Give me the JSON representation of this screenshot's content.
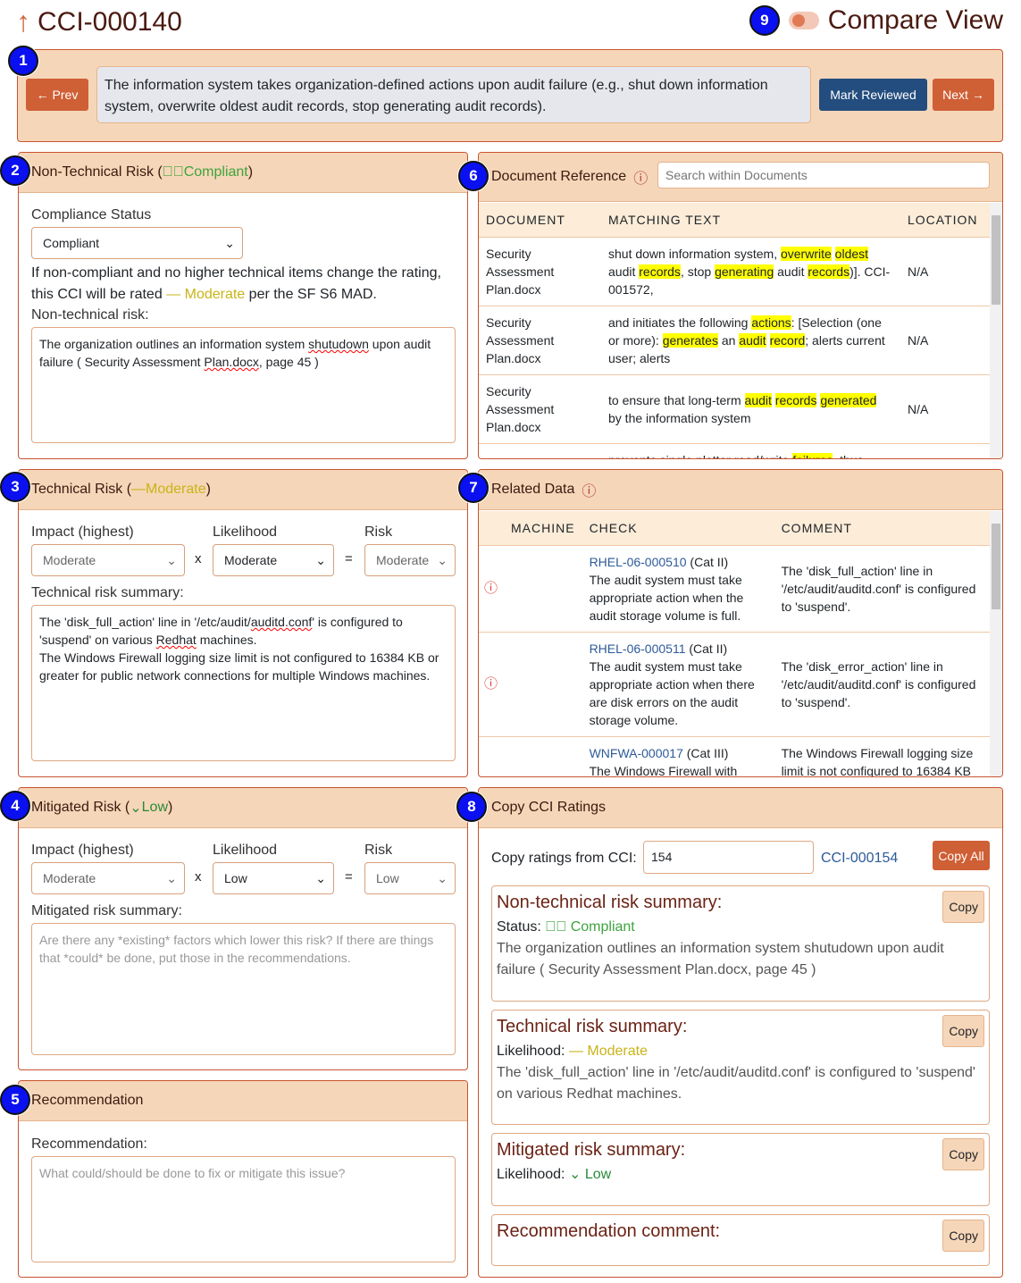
{
  "header": {
    "title": "CCI-000140",
    "compare_label": "Compare View",
    "compare_on": false
  },
  "badges": [
    "1",
    "2",
    "3",
    "4",
    "5",
    "6",
    "7",
    "8",
    "9"
  ],
  "nav": {
    "prev": "Prev",
    "next": "Next",
    "mark_reviewed": "Mark Reviewed",
    "description": "The information system takes organization-defined actions upon audit failure (e.g., shut down information system, overwrite oldest audit records, stop generating audit records)."
  },
  "nontech": {
    "title": "Non-Technical Risk (",
    "status": "Compliant",
    "close": ")",
    "compliance_label": "Compliance Status",
    "compliance_value": "Compliant",
    "note_pre": "If non-compliant and no higher technical items change the rating, this CCI will be rated ",
    "note_rating": "Moderate",
    "note_post": " per the SF S6 MAD.",
    "risk_label": "Non-technical risk:",
    "risk_text_1": "The organization outlines an information system ",
    "risk_text_sq1": "shutudown",
    "risk_text_2": " upon audit failure ( Security Assessment ",
    "risk_text_sq2": "Plan.docx",
    "risk_text_3": ", page 45 )"
  },
  "tech": {
    "title": "Technical Risk (",
    "rating": "Moderate",
    "close": ")",
    "impact_label": "Impact (highest)",
    "likelihood_label": "Likelihood",
    "risk_label": "Risk",
    "impact": "Moderate",
    "likelihood": "Moderate",
    "risk": "Moderate",
    "x": "x",
    "eq": "=",
    "summary_label": "Technical risk summary:",
    "summary_1": "The 'disk_full_action' line in '/etc/audit/",
    "summary_sq1": "auditd.conf",
    "summary_2": "' is configured to 'suspend' on various ",
    "summary_sq2": "Redhat",
    "summary_3": " machines.",
    "summary_4": "The Windows Firewall logging size limit is not configured to 16384 KB or greater for public network connections for multiple Windows machines."
  },
  "mitigated": {
    "title": "Mitigated Risk (",
    "rating": "Low",
    "close": ")",
    "impact_label": "Impact (highest)",
    "likelihood_label": "Likelihood",
    "risk_label": "Risk",
    "impact": "Moderate",
    "likelihood": "Low",
    "risk": "Low",
    "x": "x",
    "eq": "=",
    "summary_label": "Mitigated risk summary:",
    "placeholder": "Are there any *existing* factors which lower this risk? If there are things that *could* be done, put those in the recommendations."
  },
  "recommendation": {
    "title": "Recommendation",
    "label": "Recommendation:",
    "placeholder": "What could/should be done to fix or mitigate this issue?"
  },
  "docref": {
    "title": "Document Reference",
    "search_placeholder": "Search within Documents",
    "columns": [
      "DOCUMENT",
      "MATCHING TEXT",
      "LOCATION"
    ],
    "rows": [
      {
        "doc": "Security Assessment Plan.docx",
        "parts": [
          [
            "shut down information system, ",
            0
          ],
          [
            "overwrite",
            1
          ],
          [
            " ",
            0
          ],
          [
            "oldest",
            1
          ],
          [
            " audit ",
            0
          ],
          [
            "records",
            1
          ],
          [
            ", stop ",
            0
          ],
          [
            "generating",
            1
          ],
          [
            " audit ",
            0
          ],
          [
            "records",
            1
          ],
          [
            ")]. CCI-001572,",
            0
          ]
        ],
        "loc": "N/A"
      },
      {
        "doc": "Security Assessment Plan.docx",
        "parts": [
          [
            "and initiates the following ",
            0
          ],
          [
            "actions",
            1
          ],
          [
            ": [Selection (one or more): ",
            0
          ],
          [
            "generates",
            1
          ],
          [
            " an ",
            0
          ],
          [
            "audit",
            1
          ],
          [
            " ",
            0
          ],
          [
            "record",
            1
          ],
          [
            "; alerts current user; alerts",
            0
          ]
        ],
        "loc": "N/A"
      },
      {
        "doc": "Security Assessment Plan.docx",
        "parts": [
          [
            "to ensure that long-term ",
            0
          ],
          [
            "audit",
            1
          ],
          [
            " ",
            0
          ],
          [
            "records",
            1
          ],
          [
            " ",
            0
          ],
          [
            "generated",
            1
          ],
          [
            " by the information system",
            0
          ]
        ],
        "loc": "N/A"
      },
      {
        "doc": "",
        "parts": [
          [
            "prevents single platter read/write ",
            0
          ],
          [
            "failures",
            1
          ],
          [
            ", thus",
            0
          ]
        ],
        "loc": ""
      }
    ]
  },
  "related": {
    "title": "Related Data",
    "columns": [
      "MACHINE",
      "CHECK",
      "COMMENT"
    ],
    "rows": [
      {
        "id": "RHEL-06-000510",
        "cat": " (Cat II)",
        "desc": "The audit system must take appropriate action when the audit storage volume is full.",
        "comment": "The 'disk_full_action' line in '/etc/audit/auditd.conf' is configured to 'suspend'."
      },
      {
        "id": "RHEL-06-000511",
        "cat": " (Cat II)",
        "desc": "The audit system must take appropriate action when there are disk errors on the audit storage volume.",
        "comment": "The 'disk_error_action' line in '/etc/audit/auditd.conf' is configured to 'suspend'."
      },
      {
        "id": "WNFWA-000017",
        "cat": " (Cat III)",
        "desc": "The Windows Firewall with",
        "comment": "The Windows Firewall logging size limit is not configured to 16384 KB"
      }
    ]
  },
  "copy": {
    "title": "Copy CCI Ratings",
    "from_label": "Copy ratings from CCI:",
    "from_value": "154",
    "cci_link": "CCI-000154",
    "copy_all": "Copy All",
    "copy": "Copy",
    "nontech_title": "Non-technical risk summary:",
    "status_label": "Status: ",
    "status": "Compliant",
    "nontech_text": "The organization outlines an information system shutudown upon audit failure ( Security Assessment Plan.docx, page 45 )",
    "tech_title": "Technical risk summary:",
    "likelihood_label": "Likelihood: ",
    "tech_likelihood": "Moderate",
    "tech_text": "The 'disk_full_action' line in '/etc/audit/auditd.conf' is configured to 'suspend' on various Redhat machines.",
    "mit_title": "Mitigated risk summary:",
    "mit_likelihood": "Low",
    "rec_title": "Recommendation comment:"
  },
  "colors": {
    "accent": "#cf5f35",
    "navy": "#234d7e",
    "header_bg": "#f6d6b8",
    "compliant": "#3ea33e",
    "moderate": "#c8b418",
    "badge": "#0a10f0"
  }
}
